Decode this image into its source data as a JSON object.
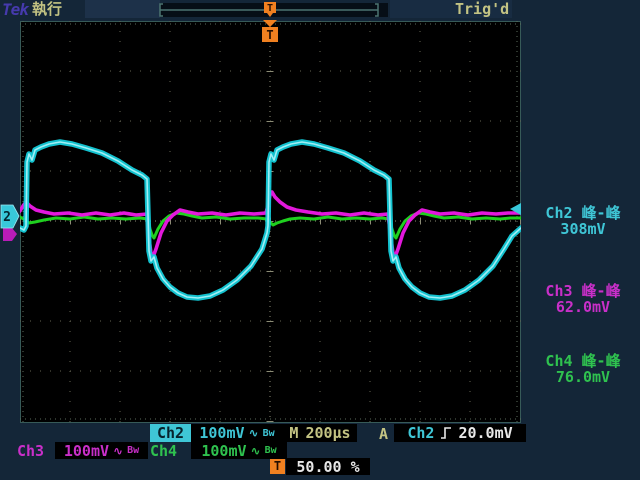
{
  "header": {
    "brand": "Tek",
    "run_status": "執行",
    "trigger_status": "Trig'd"
  },
  "markers": {
    "ch2_ground": "2",
    "trigger_position_top": "T",
    "trigger_record_mini": "T",
    "horizontal_position_badge": "T"
  },
  "measurements": [
    {
      "id": "ch2",
      "label": "Ch2 峰-峰",
      "value": "308mV"
    },
    {
      "id": "ch3",
      "label": "Ch3 峰-峰",
      "value": "62.0mV"
    },
    {
      "id": "ch4",
      "label": "Ch4 峰-峰",
      "value": "76.0mV"
    }
  ],
  "status_bar": {
    "ch2_label": "Ch2",
    "ch2_scale": "100mV",
    "ch3_label": "Ch3",
    "ch3_scale": "100mV",
    "ch4_label": "Ch4",
    "ch4_scale": "100mV",
    "coupling_icon": "∿",
    "bandwidth_icon": "Bw",
    "timebase_label": "M",
    "timebase_value": "200µs",
    "acquisition_label": "A",
    "trigger_source": "Ch2",
    "trigger_level": "20.0mV",
    "horizontal_position": "50.00 %"
  },
  "colors": {
    "background": "#142638",
    "screen": "#000000",
    "ch2_cyan": "#3fc6d6",
    "ch3_magenta": "#c92fc9",
    "ch4_green": "#2fc24f",
    "trigger_orange": "#f08020",
    "readout_khaki": "#c3c383",
    "readout_white": "#e8e8e8"
  }
}
